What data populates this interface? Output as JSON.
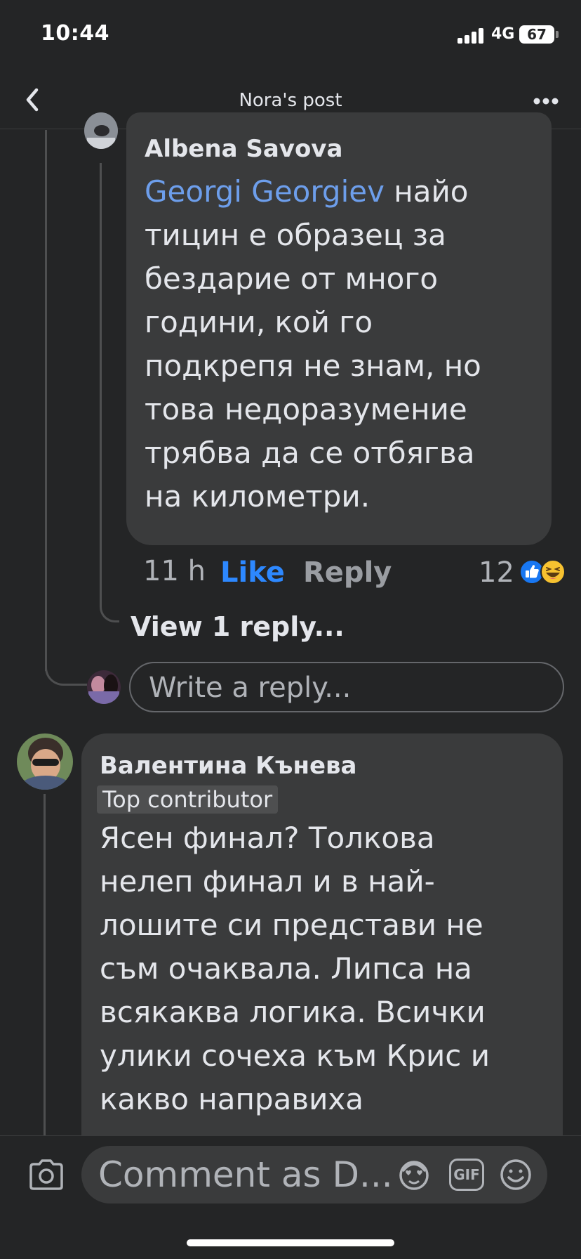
{
  "status_bar": {
    "time": "10:44",
    "network": "4G",
    "battery": "67"
  },
  "header": {
    "title": "Nora's post"
  },
  "comments": [
    {
      "author": "Albena Savova",
      "mention": "Georgi Georgiev",
      "text_lines": [
        " найо",
        "тицин е образец за",
        "бездарие от много",
        "години, кой го",
        "подкрепя не знам, но",
        "това недоразумение",
        "трябва да се отбягва",
        "на километри."
      ],
      "time": "11 h",
      "like_label": "Like",
      "reply_label": "Reply",
      "reaction_count": "12",
      "reactions": [
        "like-icon",
        "haha-icon"
      ]
    },
    {
      "author": "Валентина Кънева",
      "badge": "Top contributor",
      "text_lines": [
        "Ясен финал? Толкова",
        "нелеп финал и в най-",
        "лошите си представи не",
        "съм очаквала. Липса на",
        "всякаква логика. Всички",
        "улики сочеха към Крис и",
        "какво направиха"
      ]
    }
  ],
  "view_replies": "View 1 reply...",
  "reply_box": {
    "placeholder": "Write a reply..."
  },
  "composer": {
    "placeholder": "Comment as D..."
  },
  "colors": {
    "background": "#242526",
    "bubble": "#3a3b3c",
    "link": "#2d88ff",
    "mention": "#6d9eeb"
  }
}
